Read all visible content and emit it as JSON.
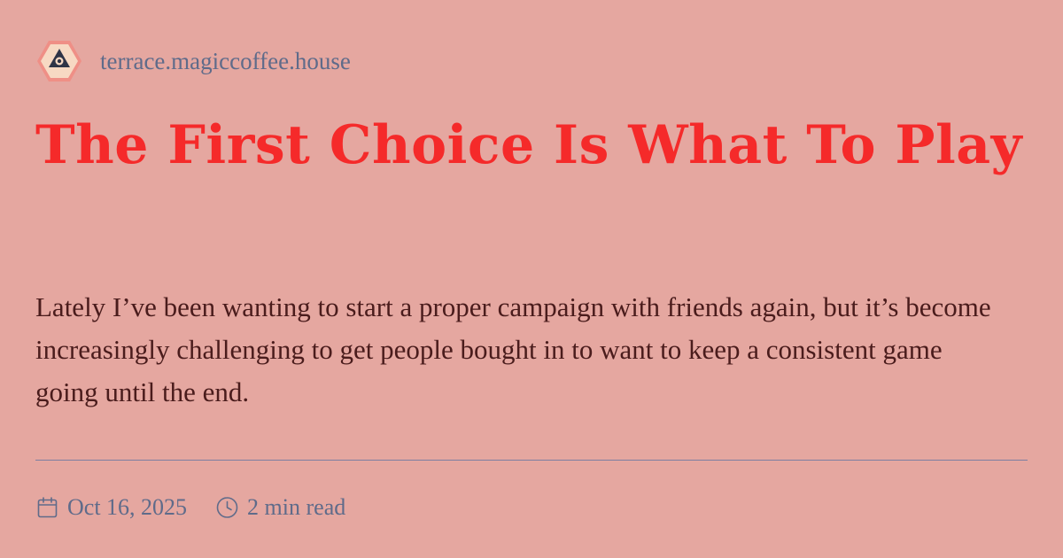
{
  "site": {
    "name": "terrace.magiccoffee.house",
    "logo_icon": "hexagon-eye-logo-icon"
  },
  "post": {
    "title": "The First Choice Is What To Play",
    "excerpt": "Lately I’ve been wanting to start a proper campaign with friends again, but it’s become increasingly challenging to get people bought in to want to keep a consistent game going until the end."
  },
  "meta": {
    "date": "Oct 16, 2025",
    "date_icon": "calendar-icon",
    "read_time": "2 min read",
    "read_time_icon": "clock-icon"
  },
  "colors": {
    "background": "#e5a7a0",
    "title": "#f52a2a",
    "body_text": "#4a1c1c",
    "muted_text": "#5f6b8a",
    "divider": "#7c7fa2"
  }
}
